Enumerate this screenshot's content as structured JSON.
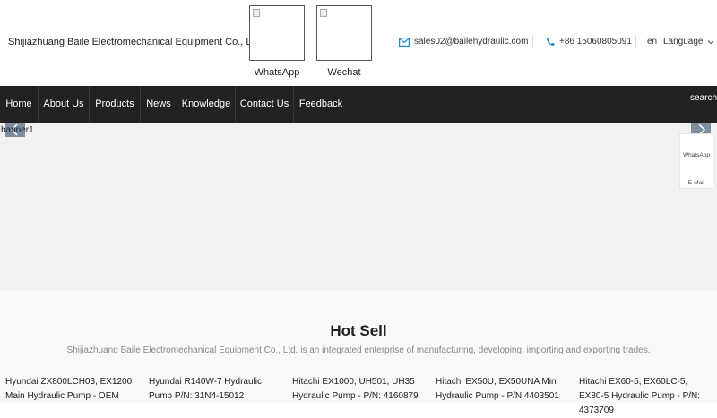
{
  "header": {
    "company": "Shijiazhuang Baile Electromechanical Equipment Co., Ltd.",
    "qr_codes": [
      {
        "label": "WhatsApp"
      },
      {
        "label": "Wechat"
      }
    ],
    "email": "sales02@bailehydraulic.com",
    "phone": "+86 15060805091",
    "lang_code": "en",
    "language_label": "Language"
  },
  "nav": {
    "items": [
      "Home",
      "About Us",
      "Products",
      "News",
      "Knowledge",
      "Contact Us",
      "Feedback"
    ],
    "search_label": "search"
  },
  "banner": {
    "alt_text": "banner1",
    "side": {
      "whatsapp": "WhatsApp",
      "email": "E-Mail"
    }
  },
  "hot_sell": {
    "title": "Hot Sell",
    "subtitle": "Shijiazhuang Baile Electromechanical Equipment Co., Ltd. is an integrated enterprise of manufacturing, developing, importing and exporting trades.",
    "products": [
      "Hyundai ZX800LCH03, EX1200 Main Hydraulic Pump - OEM",
      "Hyundai R140W-7 Hydraulic Pump P/N: 31N4-15012",
      "Hitachi EX1000, UH501, UH35 Hydraulic Pump - P/N: 4160879",
      "Hitachi EX50U, EX50UNA Mini Hydraulic Pump - P/N 4403501",
      "Hitachi EX60-5, EX60LC-5, EX80-5 Hydraulic Pump - P/N: 4373709"
    ]
  },
  "colors": {
    "nav_bg": "#222222",
    "accent": "#1e88c8"
  }
}
